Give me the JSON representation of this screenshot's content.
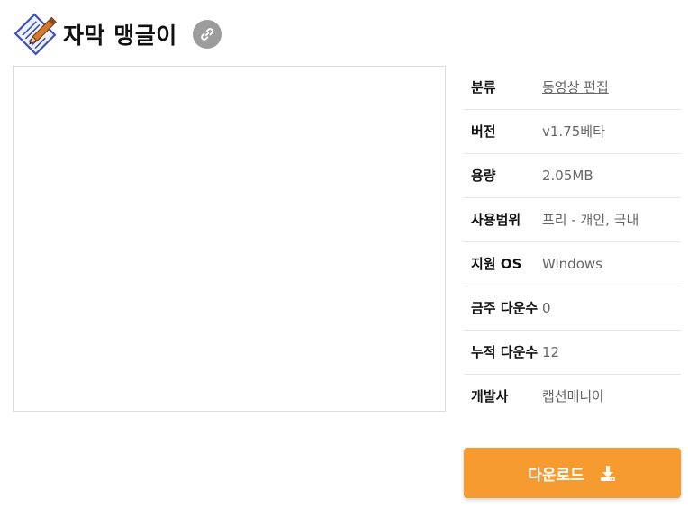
{
  "app": {
    "title": "자막 맹글이",
    "icon": "pen-and-paper-icon",
    "link_icon": "link-icon"
  },
  "details": [
    {
      "label": "분류",
      "value": "동영상 편집",
      "is_link": true
    },
    {
      "label": "버전",
      "value": "v1.75베타",
      "is_link": false
    },
    {
      "label": "용량",
      "value": "2.05MB",
      "is_link": false
    },
    {
      "label": "사용범위",
      "value": "프리 - 개인, 국내",
      "is_link": false
    },
    {
      "label": "지원 OS",
      "value": "Windows",
      "is_link": false
    },
    {
      "label": "금주 다운수",
      "value": "0",
      "is_link": false
    },
    {
      "label": "누적 다운수",
      "value": "12",
      "is_link": false
    },
    {
      "label": "개발사",
      "value": "캡션매니아",
      "is_link": false
    }
  ],
  "download": {
    "label": "다운로드",
    "icon": "download-icon",
    "color": "#f59b2f"
  }
}
